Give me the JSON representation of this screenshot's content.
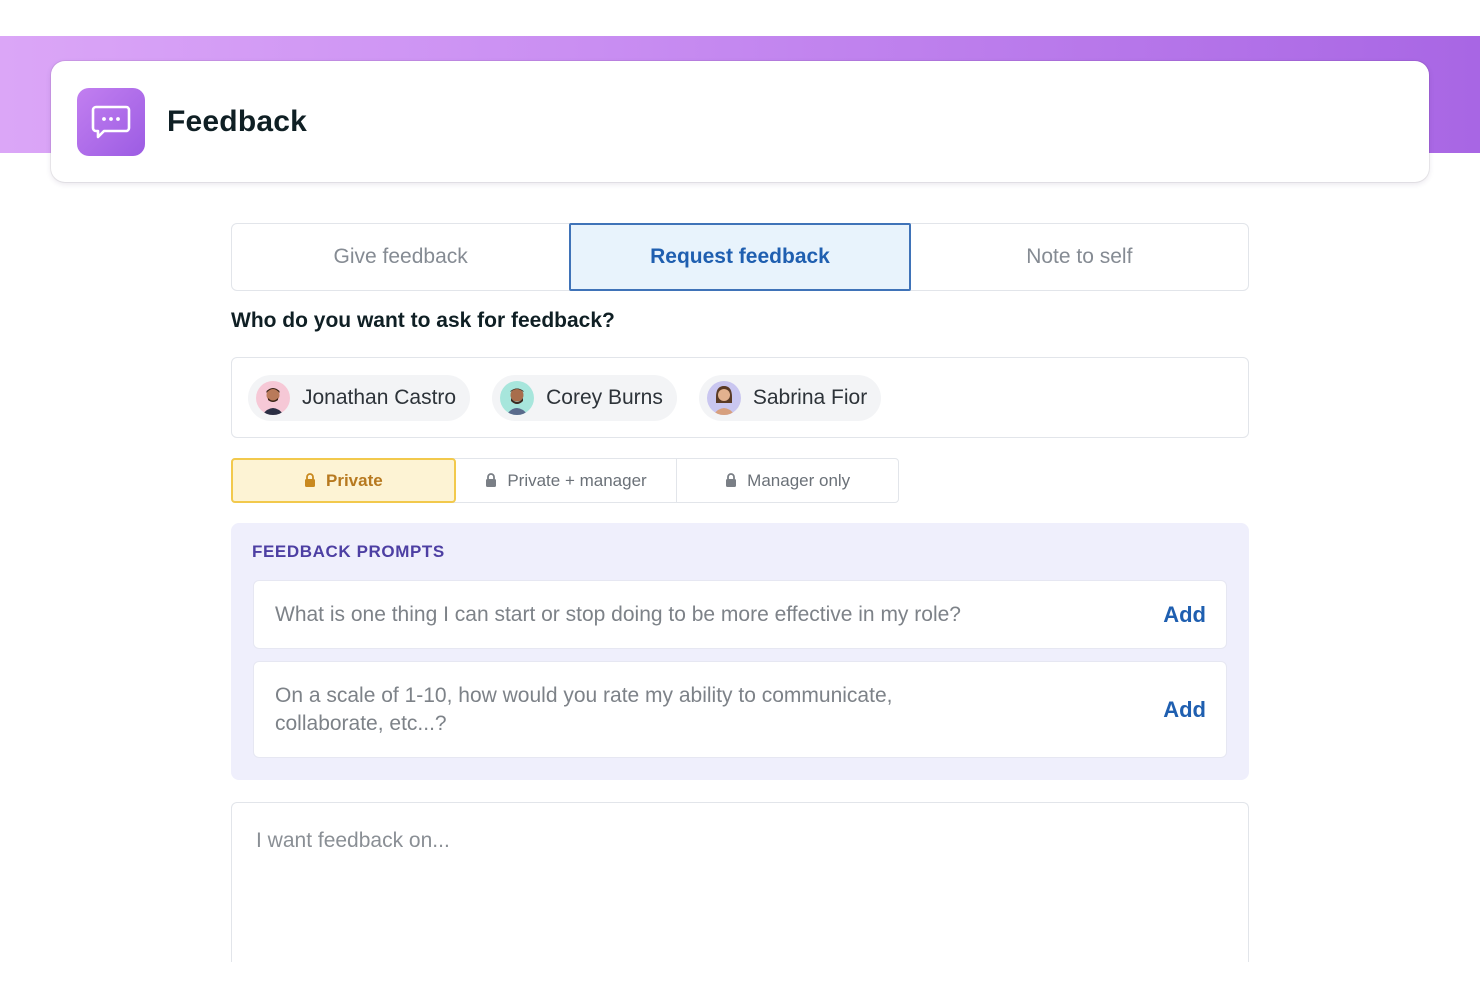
{
  "header": {
    "title": "Feedback",
    "icon": "chat-bubble-icon",
    "accent_gradient": [
      "#dba6f7",
      "#a866e4"
    ]
  },
  "tabs": [
    {
      "label": "Give feedback",
      "active": false
    },
    {
      "label": "Request feedback",
      "active": true
    },
    {
      "label": "Note to self",
      "active": false
    }
  ],
  "recipients": {
    "question": "Who do you want to ask for feedback?",
    "people": [
      {
        "name": "Jonathan Castro",
        "avatar_bg": "#f6c8d6"
      },
      {
        "name": "Corey Burns",
        "avatar_bg": "#a7e6dc"
      },
      {
        "name": "Sabrina Fior",
        "avatar_bg": "#c9c6f0"
      }
    ]
  },
  "privacy": {
    "options": [
      {
        "label": "Private",
        "active": true
      },
      {
        "label": "Private + manager",
        "active": false
      },
      {
        "label": "Manager only",
        "active": false
      }
    ]
  },
  "prompts": {
    "title": "FEEDBACK PROMPTS",
    "items": [
      {
        "text": "What is one thing I can start or stop doing to be more effective in my role?",
        "action": "Add"
      },
      {
        "text": "On a scale of 1-10, how would you rate my ability to communicate, collaborate, etc...?",
        "action": "Add"
      }
    ]
  },
  "feedback_input": {
    "placeholder": "I want feedback on..."
  },
  "colors": {
    "active_tab_border": "#3f73b8",
    "link": "#1f5fb0",
    "private_highlight": "#f2c94c"
  }
}
